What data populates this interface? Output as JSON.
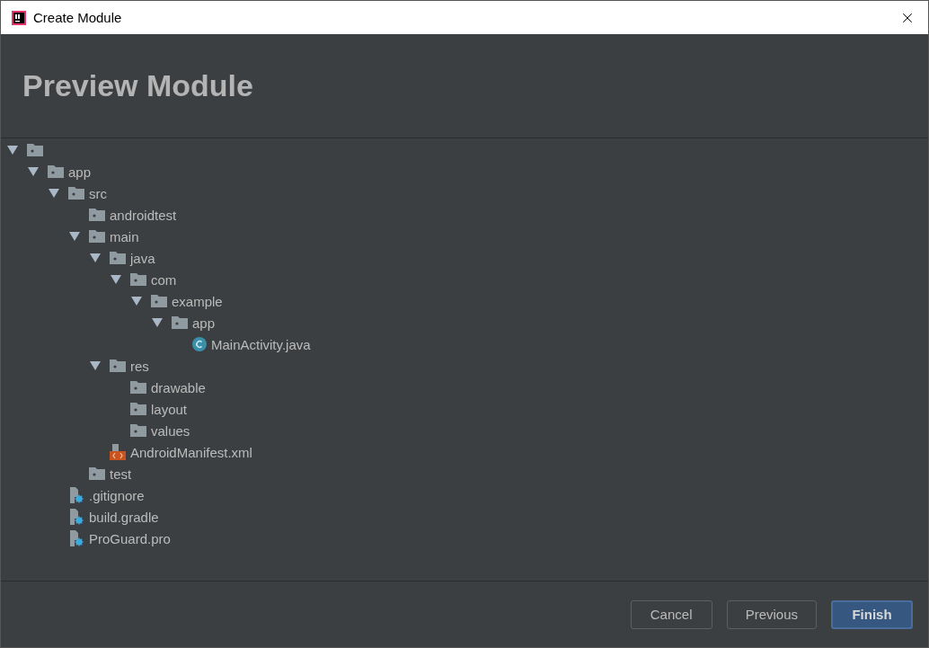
{
  "window": {
    "title": "Create Module"
  },
  "header": {
    "title": "Preview Module"
  },
  "tree": [
    {
      "kind": "folder",
      "expanded": true,
      "children": [
        {
          "kind": "folder",
          "label": "app",
          "expanded": true,
          "children": [
            {
              "kind": "folder",
              "label": "src",
              "expanded": true,
              "children": [
                {
                  "kind": "folder",
                  "label": "androidtest"
                },
                {
                  "kind": "folder",
                  "label": "main",
                  "expanded": true,
                  "children": [
                    {
                      "kind": "folder",
                      "label": "java",
                      "expanded": true,
                      "children": [
                        {
                          "kind": "folder",
                          "label": "com",
                          "expanded": true,
                          "children": [
                            {
                              "kind": "folder",
                              "label": "example",
                              "expanded": true,
                              "children": [
                                {
                                  "kind": "folder",
                                  "label": "app",
                                  "expanded": true,
                                  "children": [
                                    {
                                      "kind": "class",
                                      "label": "MainActivity.java"
                                    }
                                  ]
                                }
                              ]
                            }
                          ]
                        }
                      ]
                    },
                    {
                      "kind": "folder",
                      "label": "res",
                      "expanded": true,
                      "children": [
                        {
                          "kind": "folder",
                          "label": "drawable"
                        },
                        {
                          "kind": "folder",
                          "label": "layout"
                        },
                        {
                          "kind": "folder",
                          "label": "values"
                        }
                      ]
                    },
                    {
                      "kind": "manifest",
                      "label": "AndroidManifest.xml"
                    }
                  ]
                },
                {
                  "kind": "folder",
                  "label": "test"
                }
              ]
            },
            {
              "kind": "config",
              "label": ".gitignore"
            },
            {
              "kind": "config",
              "label": "build.gradle"
            },
            {
              "kind": "config",
              "label": "ProGuard.pro"
            }
          ]
        }
      ]
    }
  ],
  "buttons": [
    {
      "label": "Cancel",
      "primary": false
    },
    {
      "label": "Previous",
      "primary": false
    },
    {
      "label": "Finish",
      "primary": true
    }
  ]
}
